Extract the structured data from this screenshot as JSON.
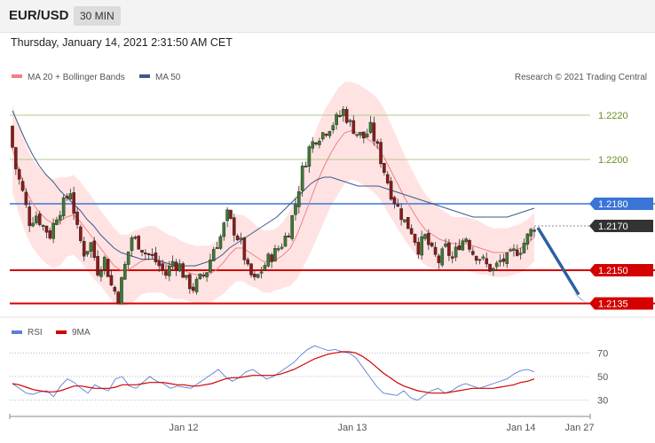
{
  "header": {
    "symbol": "EUR/USD",
    "timeframe": "30 MIN",
    "datetime": "Thursday, January 14, 2021 2:31:50 AM CET"
  },
  "colors": {
    "bull": "#3c7a32",
    "bear": "#8b1a1a",
    "ma20": "#f08080",
    "ma50": "#3a5a8c",
    "band": "#ffd9d9",
    "support": "#d40000",
    "resistance": "#3a74d6",
    "rsi": "#5b7fd4",
    "rsi_ma": "#d40000",
    "arrow": "#2f5f9e"
  },
  "chart_data": {
    "type": "candlestick",
    "legend": [
      {
        "label": "MA 20 + Bollinger Bands",
        "color": "#f08080"
      },
      {
        "label": "MA 50",
        "color": "#3a5a8c"
      }
    ],
    "copyright": "Research © 2021 Trading Central",
    "price_range": [
      2132,
      2232
    ],
    "x_ticks": [
      "Jan 12",
      "Jan 13",
      "Jan 14",
      "Jan 27"
    ],
    "levels": [
      {
        "value": "1.2220",
        "price": 2220,
        "kind": "thin-green"
      },
      {
        "value": "1.2200",
        "price": 2200,
        "kind": "thin-green"
      },
      {
        "value": "1.2180",
        "price": 2180,
        "kind": "resistance"
      },
      {
        "value": "1.2170",
        "price": 2170,
        "kind": "last"
      },
      {
        "value": "1.2150",
        "price": 2150,
        "kind": "support"
      },
      {
        "value": "1.2135",
        "price": 2135,
        "kind": "support"
      }
    ],
    "close_path": [
      2215,
      2196,
      2185,
      2172,
      2175,
      2170,
      2166,
      2175,
      2180,
      2186,
      2168,
      2158,
      2162,
      2150,
      2155,
      2143,
      2138,
      2152,
      2165,
      2162,
      2158,
      2156,
      2152,
      2148,
      2154,
      2152,
      2145,
      2142,
      2146,
      2150,
      2160,
      2165,
      2175,
      2168,
      2162,
      2150,
      2145,
      2150,
      2155,
      2158,
      2162,
      2168,
      2180,
      2195,
      2205,
      2210,
      2212,
      2215,
      2218,
      2222,
      2216,
      2212,
      2210,
      2214,
      2205,
      2195,
      2185,
      2178,
      2172,
      2168,
      2160,
      2165,
      2158,
      2154,
      2160,
      2155,
      2162,
      2165,
      2158,
      2156,
      2152,
      2150,
      2154,
      2155,
      2158,
      2160,
      2165,
      2170
    ],
    "ma20": [
      2205,
      2195,
      2186,
      2180,
      2176,
      2173,
      2171,
      2172,
      2174,
      2175,
      2172,
      2168,
      2164,
      2160,
      2156,
      2152,
      2150,
      2150,
      2152,
      2154,
      2155,
      2155,
      2154,
      2152,
      2151,
      2150,
      2149,
      2148,
      2148,
      2148,
      2150,
      2153,
      2157,
      2160,
      2160,
      2158,
      2156,
      2154,
      2154,
      2155,
      2157,
      2160,
      2166,
      2174,
      2182,
      2190,
      2197,
      2203,
      2208,
      2212,
      2213,
      2212,
      2210,
      2208,
      2205,
      2200,
      2194,
      2188,
      2182,
      2177,
      2172,
      2168,
      2166,
      2164,
      2163,
      2162,
      2162,
      2162,
      2161,
      2160,
      2159,
      2158,
      2158,
      2158,
      2159,
      2160,
      2162,
      2165
    ],
    "ma50": [
      2222,
      2215,
      2208,
      2202,
      2197,
      2193,
      2190,
      2186,
      2183,
      2180,
      2177,
      2173,
      2170,
      2166,
      2163,
      2160,
      2158,
      2157,
      2156,
      2155,
      2155,
      2155,
      2154,
      2153,
      2152,
      2152,
      2152,
      2152,
      2153,
      2154,
      2155,
      2157,
      2160,
      2162,
      2164,
      2166,
      2168,
      2170,
      2172,
      2174,
      2177,
      2180,
      2183,
      2186,
      2189,
      2191,
      2192,
      2192,
      2191,
      2190,
      2189,
      2188,
      2188,
      2188,
      2188,
      2187,
      2186,
      2185,
      2184,
      2183,
      2182,
      2181,
      2180,
      2179,
      2178,
      2177,
      2176,
      2175,
      2174,
      2174,
      2174,
      2174,
      2174,
      2174,
      2175,
      2176,
      2177,
      2178
    ],
    "band_width": [
      20,
      20,
      20,
      20,
      20,
      20,
      20,
      20,
      18,
      18,
      18,
      18,
      18,
      17,
      17,
      17,
      16,
      16,
      16,
      15,
      15,
      15,
      14,
      14,
      14,
      13,
      13,
      13,
      13,
      13,
      13,
      14,
      15,
      15,
      15,
      15,
      14,
      14,
      14,
      14,
      15,
      17,
      20,
      22,
      24,
      25,
      25,
      24,
      24,
      23,
      22,
      22,
      22,
      22,
      22,
      22,
      21,
      20,
      19,
      18,
      17,
      16,
      15,
      14,
      13,
      12,
      12,
      12,
      12,
      12,
      11,
      11,
      11,
      11,
      11,
      11,
      11,
      11
    ],
    "rsi": {
      "legend": [
        {
          "label": "RSI",
          "color": "#5b7fd4"
        },
        {
          "label": "9MA",
          "color": "#d40000"
        }
      ],
      "y_ticks": [
        "70",
        "50",
        "30"
      ],
      "range": [
        20,
        80
      ],
      "rsi_values": [
        44,
        40,
        36,
        35,
        37,
        38,
        33,
        42,
        48,
        45,
        40,
        36,
        43,
        40,
        38,
        48,
        50,
        42,
        40,
        45,
        50,
        46,
        44,
        40,
        42,
        41,
        40,
        44,
        48,
        52,
        56,
        50,
        46,
        49,
        54,
        56,
        52,
        48,
        50,
        54,
        58,
        62,
        68,
        73,
        76,
        74,
        72,
        73,
        71,
        70,
        66,
        58,
        50,
        42,
        36,
        35,
        34,
        38,
        32,
        30,
        34,
        38,
        40,
        36,
        38,
        42,
        44,
        42,
        40,
        42,
        44,
        46,
        48,
        52,
        55,
        56,
        54
      ],
      "ma9_values": [
        44,
        43,
        41,
        39,
        38,
        37,
        37,
        38,
        40,
        42,
        42,
        41,
        40,
        40,
        40,
        41,
        43,
        43,
        43,
        44,
        45,
        45,
        45,
        44,
        43,
        43,
        42,
        42,
        43,
        44,
        46,
        48,
        49,
        49,
        50,
        51,
        51,
        51,
        51,
        52,
        54,
        56,
        59,
        62,
        65,
        67,
        69,
        70,
        71,
        71,
        70,
        67,
        63,
        58,
        53,
        49,
        45,
        42,
        40,
        38,
        37,
        36,
        36,
        36,
        37,
        38,
        39,
        40,
        40,
        40,
        40,
        41,
        42,
        43,
        45,
        46,
        48
      ],
      "guide_70": 70,
      "guide_50": 50,
      "guide_30": 30
    }
  }
}
